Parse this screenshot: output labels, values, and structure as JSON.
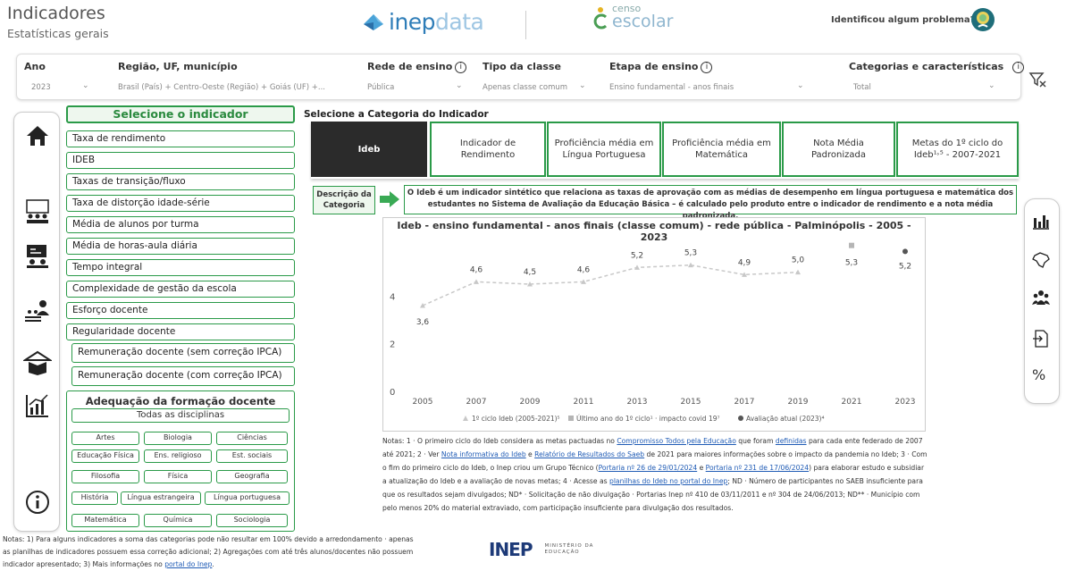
{
  "header": {
    "title": "Indicadores",
    "subtitle": "Estatísticas gerais",
    "brand_a": "inep",
    "brand_b": "data",
    "censo_small": "censo",
    "censo_big": "escolar",
    "report_label": "Identificou algum problema?"
  },
  "filters": [
    {
      "label": "Ano",
      "value": "2023"
    },
    {
      "label": "Região, UF, município",
      "value": "Brasil (País) + Centro-Oeste (Região) + Goiás (UF) +..."
    },
    {
      "label": "Rede de ensino",
      "value": "Pública"
    },
    {
      "label": "Tipo da classe",
      "value": "Apenas classe comum"
    },
    {
      "label": "Etapa de ensino",
      "value": "Ensino fundamental - anos finais"
    },
    {
      "label": "Categorias e características",
      "value": "Total"
    }
  ],
  "indicator_header": "Selecione o indicador",
  "indicators": [
    "Taxa de rendimento",
    "IDEB",
    "Taxas de transição/fluxo",
    "Taxa de distorção idade-série",
    "Média de alunos por turma",
    "Média de horas-aula diária",
    "Tempo integral",
    "Complexidade de gestão da escola",
    "Esforço docente",
    "Regularidade docente",
    "Remuneração docente (sem correção IPCA)",
    "Remuneração docente (com correção IPCA)"
  ],
  "adequacao": {
    "title": "Adequação da formação docente",
    "all": "Todas as disciplinas",
    "subjects": [
      "Artes",
      "Biologia",
      "Ciências",
      "Educação Física",
      "Ens. religioso",
      "Est. sociais",
      "Filosofia",
      "Física",
      "Geografia",
      "História",
      "Língua estrangeira",
      "Língua portuguesa",
      "Matemática",
      "Química",
      "Sociologia"
    ]
  },
  "category": {
    "title": "Selecione a Categoria do Indicador",
    "tabs": [
      "Ideb",
      "Indicador de Rendimento",
      "Proficiência média em Língua Portuguesa",
      "Proficiência média em Matemática",
      "Nota Média Padronizada",
      "Metas do 1º ciclo do Ideb¹˒⁵ - 2007-2021"
    ],
    "desc_label": "Descrição da Categoria",
    "desc_text": "O Ideb é um indicador sintético que relaciona as taxas de aprovação com as médias de desempenho em língua portuguesa e matemática dos estudantes no Sistema de Avaliação da Educação Básica – é calculado pelo produto entre o indicador de rendimento e a nota média padronizada."
  },
  "chart_data": {
    "type": "line",
    "title": "Ideb - ensino fundamental - anos finais (classe comum) - rede pública - Palminópolis - 2005 - 2023",
    "x": [
      "2005",
      "2007",
      "2009",
      "2011",
      "2013",
      "2015",
      "2017",
      "2019",
      "2021",
      "2023"
    ],
    "y_ticks": [
      "0",
      "2",
      "4"
    ],
    "ylim": [
      0,
      6
    ],
    "series": [
      {
        "name": "1º ciclo Ideb (2005-2021)⁵",
        "values": [
          3.6,
          4.6,
          4.5,
          4.6,
          5.2,
          5.3,
          4.9,
          5.0,
          null,
          null
        ],
        "labels": [
          "3,6",
          "4,6",
          "4,5",
          "4,6",
          "5,2",
          "5,3",
          "4,9",
          "5,0",
          null,
          null
        ],
        "color": "#c8c8c8"
      },
      {
        "name": "Último ano do 1º ciclo¹ · impacto covid 19⁷",
        "values": [
          null,
          null,
          null,
          null,
          null,
          null,
          null,
          null,
          5.3,
          null
        ],
        "labels": [
          null,
          null,
          null,
          null,
          null,
          null,
          null,
          null,
          "5,3",
          null
        ],
        "color": "#b5b5b5"
      },
      {
        "name": "Avaliação atual (2023)⁴",
        "values": [
          null,
          null,
          null,
          null,
          null,
          null,
          null,
          null,
          null,
          5.2
        ],
        "labels": [
          null,
          null,
          null,
          null,
          null,
          null,
          null,
          null,
          null,
          "5,2"
        ],
        "color": "#555555"
      }
    ],
    "legend": "bottom"
  },
  "notes": {
    "p1": "Notas: 1 · O primeiro ciclo do Ideb considera as metas pactuadas no ",
    "l1": "Compromisso Todos pela Educação",
    "p2": " que foram ",
    "l2": "definidas",
    "p3": " para cada ente federado de 2007 até 2021; 2 · Ver ",
    "l3": "Nota informativa do Ideb",
    "p4": " e ",
    "l4": "Relatório de Resultados do Saeb",
    "p5": " de 2021 para maiores informações sobre o impacto da pandemia no Ideb; 3 · Com o fim do primeiro ciclo do Ideb, o Inep criou um Grupo Técnico (",
    "l5": "Portaria nº 26 de 29/01/2024",
    "p6": " e ",
    "l6": "Portaria nº 231 de 17/06/2024",
    "p7": ") para elaborar estudo e subsidiar a atualização do Ideb e a avaliação de novas metas; 4 · Acesse as ",
    "l7": "planilhas do Ideb no portal do Inep",
    "p8": "; ND · Número de participantes no SAEB insuficiente para que os resultados sejam divulgados; ND* · Solicitação de não divulgação · Portarias Inep nº 410 de 03/11/2011 e nº 304 de 24/06/2013; ND** · Município com pelo menos 20% do material extraviado, com participação insuficiente para divulgação dos resultados."
  },
  "footer": {
    "text": "Notas: 1) Para alguns indicadores a soma das categorias pode não resultar em 100% devido a arredondamento · apenas as planilhas de indicadores possuem essa correção adicional; 2) Agregações com até três alunos/docentes não possuem indicador apresentado; 3) Mais informações no ",
    "link": "portal do Inep",
    "tail": ".",
    "inep": "INEP",
    "ministerio": "MINISTÉRIO DA",
    "educacao": "EDUCAÇÃO"
  },
  "right_toolbar": {
    "percent": "%"
  }
}
